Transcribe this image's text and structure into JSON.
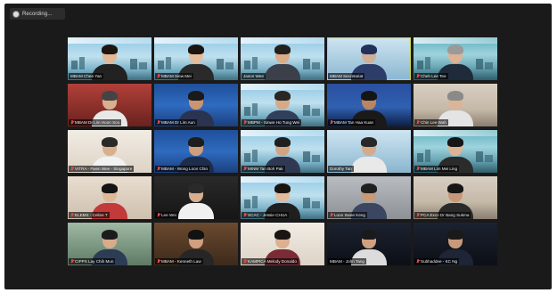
{
  "recording": {
    "label": "Recording..."
  },
  "participants": [
    {
      "name": "MBAM Chee Yan",
      "bg": "bg-sky",
      "skin": "#e3b896",
      "hair": "#1d1611",
      "shirt": "#222",
      "banner": true,
      "muted": false,
      "active": false
    },
    {
      "name": "MBAM Siew Mei",
      "bg": "bg-sky",
      "skin": "#e6bd9c",
      "hair": "#1b1410",
      "shirt": "#2a2a2a",
      "banner": true,
      "muted": true,
      "active": false
    },
    {
      "name": "Jason Wee",
      "bg": "bg-sky",
      "skin": "#d9ad8a",
      "hair": "#23201d",
      "shirt": "#3a3f4a",
      "banner": true,
      "muted": false,
      "active": false
    },
    {
      "name": "MBAM Secretariat",
      "bg": "bg-lightblue",
      "skin": "#ceb098",
      "hair": "#23305a",
      "shirt": "#2c3d6a",
      "banner": false,
      "muted": false,
      "active": true
    },
    {
      "name": "Cheh Lee Tee",
      "bg": "bg-teal",
      "skin": "#dcb394",
      "hair": "#9a9a9a",
      "shirt": "#1f2a3a",
      "banner": true,
      "muted": true,
      "active": false
    },
    {
      "name": "MBAM Dr Lim Hoon Soo",
      "bg": "bg-red",
      "skin": "#d9b08f",
      "hair": "#444",
      "shirt": "#e8e8e8",
      "banner": false,
      "muted": true,
      "active": false
    },
    {
      "name": "MBAM Dr Lim Aun",
      "bg": "bg-blue",
      "skin": "#c99574",
      "hair": "#1a1a1a",
      "shirt": "#2a3350",
      "banner": false,
      "muted": true,
      "active": false
    },
    {
      "name": "MBPM - Sinwe Ho Tung Wei",
      "bg": "bg-sky",
      "skin": "#d6a988",
      "hair": "#2a2622",
      "shirt": "#30405a",
      "banner": true,
      "muted": true,
      "active": false
    },
    {
      "name": "MBAM Tan Haa Kuan",
      "bg": "bg-stage",
      "skin": "#b98663",
      "hair": "#151515",
      "shirt": "#1a1a1a",
      "banner": false,
      "muted": true,
      "active": false
    },
    {
      "name": "Chin Lee Wah",
      "bg": "bg-office",
      "skin": "#dcb597",
      "hair": "#8a8a8a",
      "shirt": "#e4e4e4",
      "banner": false,
      "muted": true,
      "active": false
    },
    {
      "name": "VITRA - Fwen Wee - Singapore",
      "bg": "bg-cream",
      "skin": "#d8b08e",
      "hair": "#2a2a2a",
      "shirt": "#f2f2f2",
      "banner": false,
      "muted": true,
      "active": false
    },
    {
      "name": "MBAM - Wong Loon Chin",
      "bg": "bg-blue",
      "skin": "#cf9e7c",
      "hair": "#1d1d1d",
      "shirt": "#1f2d4d",
      "banner": false,
      "muted": true,
      "active": false
    },
    {
      "name": "MINM Tan Boh Pak",
      "bg": "bg-sky",
      "skin": "#d3a482",
      "hair": "#1f1f1f",
      "shirt": "#2f3a52",
      "banner": true,
      "muted": true,
      "active": false
    },
    {
      "name": "Dorothy Tan",
      "bg": "bg-lightblue",
      "skin": "#d5ab8b",
      "hair": "#282828",
      "shirt": "#e9e9e9",
      "banner": false,
      "muted": false,
      "active": false
    },
    {
      "name": "MBAM Lim Mei Ling",
      "bg": "bg-teal",
      "skin": "#dcb496",
      "hair": "#171717",
      "shirt": "#2b2b2b",
      "banner": true,
      "muted": true,
      "active": false
    },
    {
      "name": "ELEMS - Celine T",
      "bg": "bg-beige",
      "skin": "#e0b898",
      "hair": "#141414",
      "shirt": "#c23a3a",
      "banner": false,
      "muted": true,
      "active": false
    },
    {
      "name": "Lee Wei",
      "bg": "bg-dark",
      "skin": "#d8ae8e",
      "hair": "#2a2a2a",
      "shirt": "#f0f0f0",
      "banner": false,
      "muted": true,
      "active": false
    },
    {
      "name": "SCAC - Jessie CHUA",
      "bg": "bg-sky",
      "skin": "#e2bb9c",
      "hair": "#1a1410",
      "shirt": "#1f1f1f",
      "banner": true,
      "muted": true,
      "active": false
    },
    {
      "name": "Loon Swee Keng",
      "bg": "bg-grey",
      "skin": "#c89a78",
      "hair": "#202020",
      "shirt": "#3b4660",
      "banner": false,
      "muted": true,
      "active": false
    },
    {
      "name": "PCA Exco Dr Bang Sukma",
      "bg": "bg-office",
      "skin": "#c8977a",
      "hair": "#161616",
      "shirt": "#2a2a2a",
      "banner": false,
      "muted": true,
      "active": false
    },
    {
      "name": "CIPPS Lay Chih Mun",
      "bg": "bg-green",
      "skin": "#d8ab8a",
      "hair": "#1c1c1c",
      "shirt": "#2c3c55",
      "banner": false,
      "muted": true,
      "active": false
    },
    {
      "name": "MBAM - Kenneth Law",
      "bg": "bg-wood",
      "skin": "#cf9f80",
      "hair": "#121212",
      "shirt": "#262626",
      "banner": false,
      "muted": true,
      "active": false
    },
    {
      "name": "KAMPICA Melody Donaldo",
      "bg": "bg-cream",
      "skin": "#dcb091",
      "hair": "#1a1512",
      "shirt": "#7a2b36",
      "banner": false,
      "muted": true,
      "active": false
    },
    {
      "name": "MBAM - John Tang",
      "bg": "bg-night",
      "skin": "#cfa181",
      "hair": "#1a1a1a",
      "shirt": "#dcdcdc",
      "banner": false,
      "muted": false,
      "active": false
    },
    {
      "name": "Subhaddee - KC Ng",
      "bg": "bg-night",
      "skin": "#c79a7b",
      "hair": "#1a1a1a",
      "shirt": "#1d2536",
      "banner": false,
      "muted": true,
      "active": false
    }
  ]
}
